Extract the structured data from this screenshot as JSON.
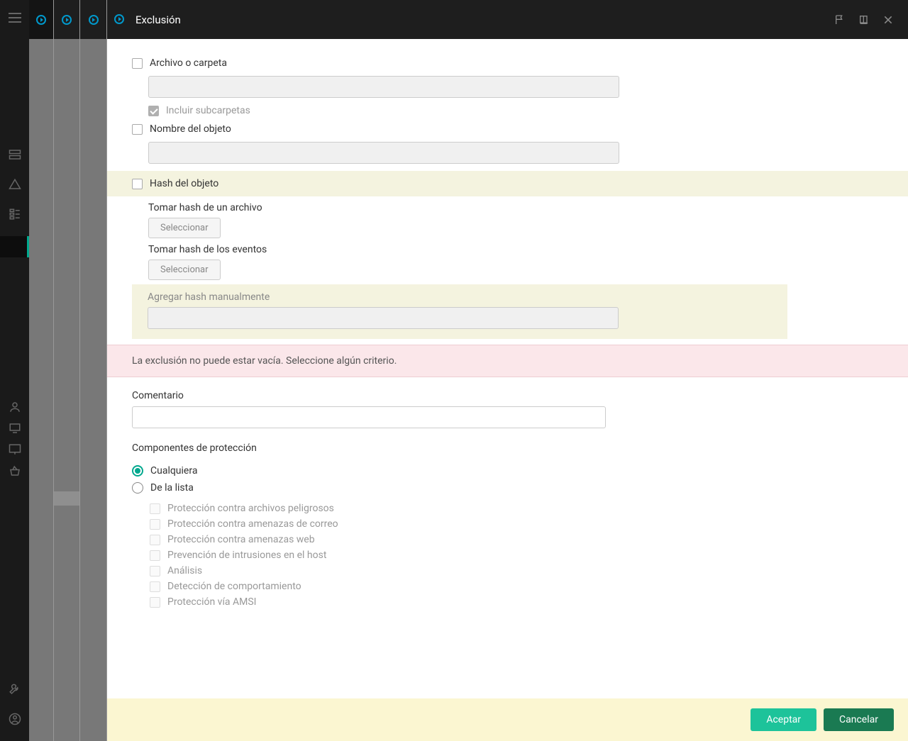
{
  "header": {
    "title": "Exclusión"
  },
  "form": {
    "file_or_folder": {
      "label": "Archivo o carpeta",
      "value": "",
      "include_subfolders_label": "Incluir subcarpetas"
    },
    "object_name": {
      "label": "Nombre del objeto",
      "value": ""
    },
    "object_hash": {
      "label": "Hash del objeto",
      "from_file_label": "Tomar hash de un archivo",
      "from_events_label": "Tomar hash de los eventos",
      "select_button": "Seleccionar",
      "manual_label": "Agregar hash manualmente",
      "manual_value": ""
    },
    "error": "La exclusión no puede estar vacía. Seleccione algún criterio.",
    "comment": {
      "label": "Comentario",
      "value": ""
    },
    "protection": {
      "title": "Componentes de protección",
      "any_label": "Cualquiera",
      "list_label": "De la lista",
      "items": [
        "Protección contra archivos peligrosos",
        "Protección contra amenazas de correo",
        "Protección contra amenazas web",
        "Prevención de intrusiones en el host",
        "Análisis",
        "Detección de comportamiento",
        "Protección vía AMSI"
      ]
    }
  },
  "footer": {
    "accept": "Aceptar",
    "cancel": "Cancelar"
  }
}
